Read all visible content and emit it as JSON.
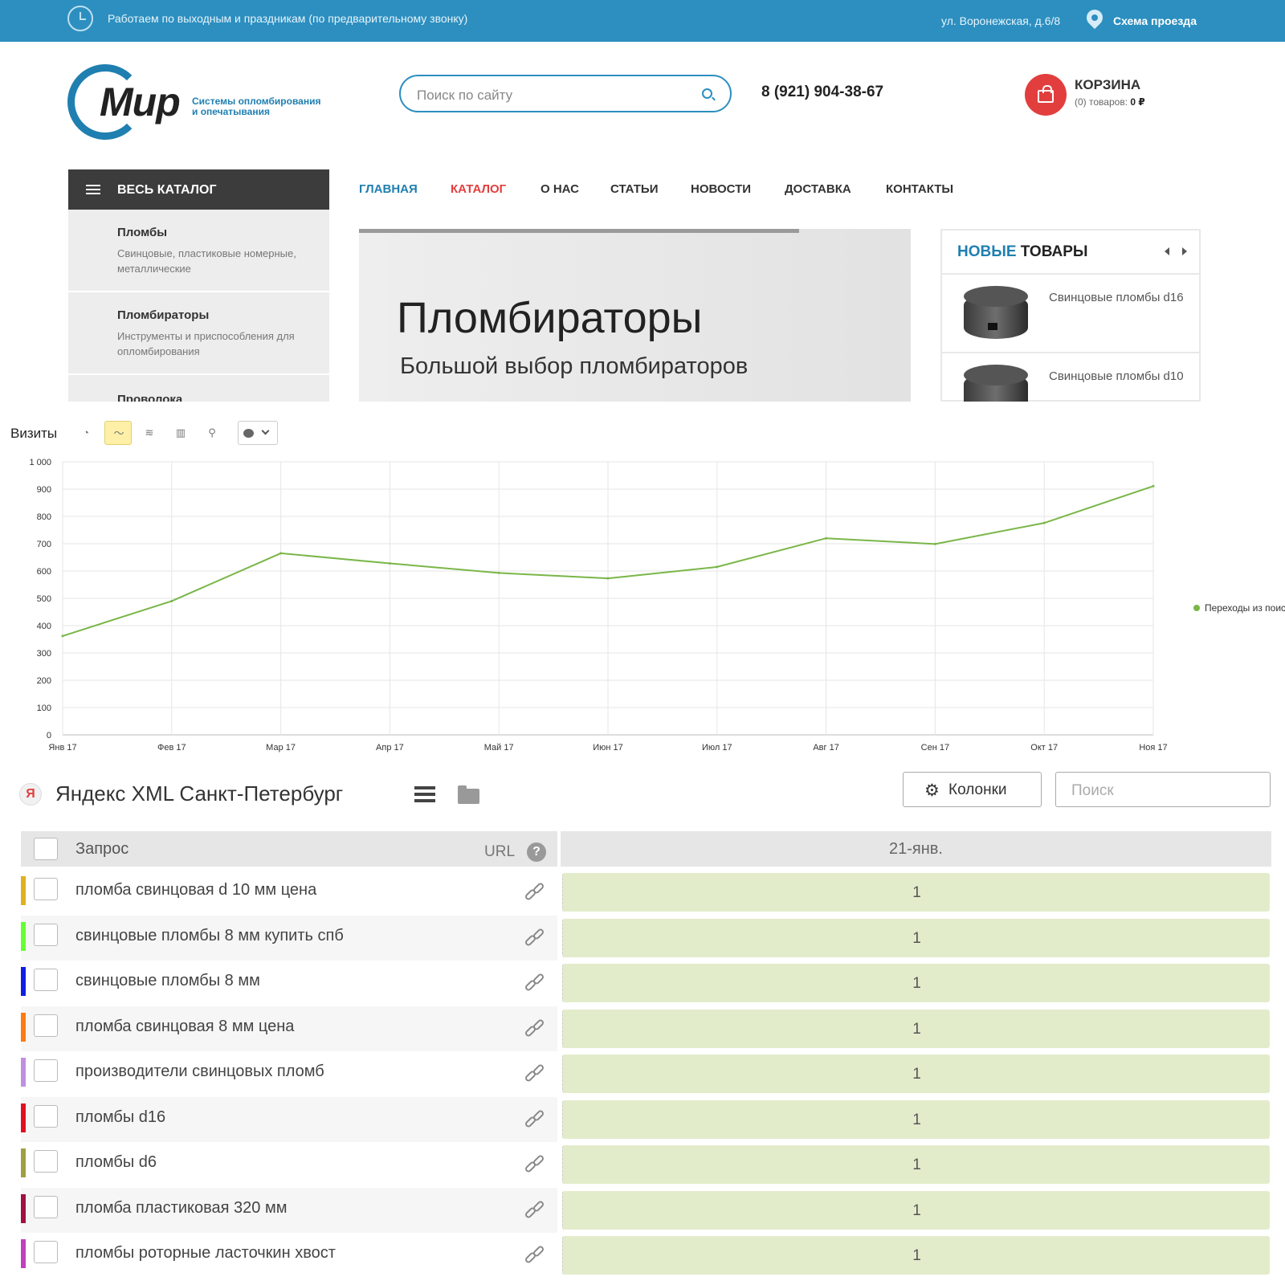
{
  "site": {
    "topbar": {
      "hours": "Работаем по выходным и праздникам (по предварительному звонку)",
      "address": "ул. Воронежская, д.6/8",
      "route": "Схема проезда"
    },
    "logo": {
      "word": "Мир",
      "tagline_1": "Системы опломбирования",
      "tagline_2": "и опечатывания"
    },
    "search_placeholder": "Поиск по сайту",
    "phone": "8 (921) 904-38-67",
    "cart": {
      "title": "КОРЗИНА",
      "count": "(0)",
      "goods_label": "товаров:",
      "sum": "0 ₽"
    },
    "catalog": {
      "title": "ВЕСЬ КАТАЛОГ",
      "items": [
        {
          "title": "Пломбы",
          "desc": "Свинцовые, пластиковые номерные, металлические"
        },
        {
          "title": "Пломбираторы",
          "desc": "Инструменты и приспособления для опломбирования"
        },
        {
          "title": "Проволока",
          "desc": ""
        }
      ]
    },
    "nav": [
      "ГЛАВНАЯ",
      "КАТАЛОГ",
      "О НАС",
      "СТАТЬИ",
      "НОВОСТИ",
      "ДОСТАВКА",
      "КОНТАКТЫ"
    ],
    "nav_colors": {
      "active": "#1f7fb0",
      "highlight": "#e23e3e",
      "default": "#333333"
    },
    "banner": {
      "title": "Пломбираторы",
      "subtitle": "Большой выбор пломбираторов"
    },
    "new_products": {
      "title_accent": "НОВЫЕ",
      "title_rest": "ТОВАРЫ",
      "items": [
        {
          "name": "Свинцовые пломбы d16"
        },
        {
          "name": "Свинцовые пломбы d10"
        }
      ]
    }
  },
  "stats": {
    "title": "Визиты",
    "toolbar_icons": [
      "pie-chart-icon",
      "line-chart-icon",
      "area-chart-icon",
      "bar-chart-icon",
      "map-icon",
      "annotation-icon"
    ],
    "active_tool": "line-chart-icon"
  },
  "chart_data": {
    "type": "line",
    "categories": [
      "Янв 17",
      "Фев 17",
      "Мар 17",
      "Апр 17",
      "Май 17",
      "Июн 17",
      "Июл 17",
      "Авг 17",
      "Сен 17",
      "Окт 17",
      "Ноя 17"
    ],
    "series": [
      {
        "name": "Переходы из поисковых систем",
        "values": [
          362,
          490,
          665,
          628,
          593,
          573,
          615,
          720,
          699,
          776,
          911
        ],
        "color": "#7ab648"
      }
    ],
    "yticks": [
      "0",
      "100",
      "200",
      "300",
      "400",
      "500",
      "600",
      "700",
      "800",
      "900",
      "1 000"
    ],
    "ylim": [
      0,
      1000
    ],
    "grid": true,
    "legend": "right"
  },
  "table": {
    "engine_icon": "Я",
    "title": "Яндекс XML Санкт-Петербург",
    "columns_button": "Колонки",
    "search_placeholder": "Поиск",
    "header": {
      "query": "Запрос",
      "url": "URL",
      "help": "?",
      "date": "21-янв."
    },
    "rows": [
      {
        "query": "пломба свинцовая d 10 мм цена",
        "pos": "1",
        "color": "#e0b020"
      },
      {
        "query": "свинцовые пломбы 8 мм купить спб",
        "pos": "1",
        "color": "#66ff33"
      },
      {
        "query": "свинцовые пломбы 8 мм",
        "pos": "1",
        "color": "#1020e0"
      },
      {
        "query": "пломба свинцовая 8 мм цена",
        "pos": "1",
        "color": "#ff7a10"
      },
      {
        "query": "производители свинцовых пломб",
        "pos": "1",
        "color": "#c090e0"
      },
      {
        "query": "пломбы d16",
        "pos": "1",
        "color": "#e01020"
      },
      {
        "query": "пломбы d6",
        "pos": "1",
        "color": "#a0a040"
      },
      {
        "query": "пломба пластиковая 320 мм",
        "pos": "1",
        "color": "#a01040"
      },
      {
        "query": "пломбы роторные ласточкин хвост",
        "pos": "1",
        "color": "#c040c0"
      }
    ]
  }
}
